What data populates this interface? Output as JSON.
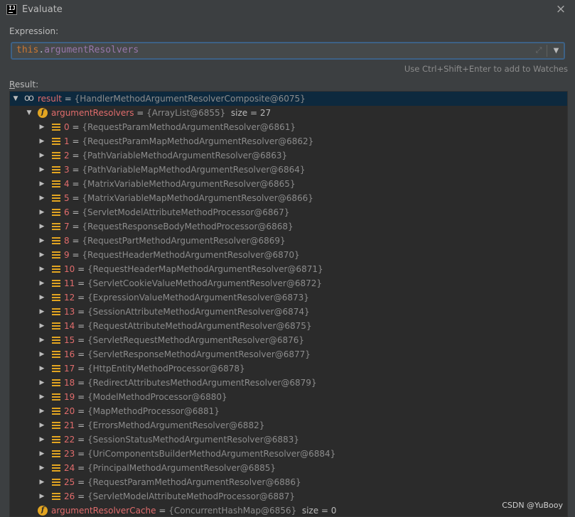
{
  "window": {
    "title": "Evaluate",
    "icon": "intellij-idea-icon",
    "close": "×"
  },
  "expression": {
    "label": "Expression:",
    "keyword": "this",
    "dot": ".",
    "field": "argumentResolvers",
    "expand_icon": "expand-icon",
    "dropdown_icon": "▼"
  },
  "hint": "Use Ctrl+Shift+Enter to add to Watches",
  "result": {
    "label_underlined": "R",
    "label_rest": "esult:",
    "root": {
      "name": "result",
      "eq": " = ",
      "value": "{HandlerMethodArgumentResolverComposite@6075}"
    },
    "resolvers": {
      "name": "argumentResolvers",
      "eq": " = ",
      "value": "{ArrayList@6855}",
      "size": "size = 27"
    },
    "items": [
      {
        "index": "0",
        "value": "{RequestParamMethodArgumentResolver@6861}"
      },
      {
        "index": "1",
        "value": "{RequestParamMapMethodArgumentResolver@6862}"
      },
      {
        "index": "2",
        "value": "{PathVariableMethodArgumentResolver@6863}"
      },
      {
        "index": "3",
        "value": "{PathVariableMapMethodArgumentResolver@6864}"
      },
      {
        "index": "4",
        "value": "{MatrixVariableMethodArgumentResolver@6865}"
      },
      {
        "index": "5",
        "value": "{MatrixVariableMapMethodArgumentResolver@6866}"
      },
      {
        "index": "6",
        "value": "{ServletModelAttributeMethodProcessor@6867}"
      },
      {
        "index": "7",
        "value": "{RequestResponseBodyMethodProcessor@6868}"
      },
      {
        "index": "8",
        "value": "{RequestPartMethodArgumentResolver@6869}"
      },
      {
        "index": "9",
        "value": "{RequestHeaderMethodArgumentResolver@6870}"
      },
      {
        "index": "10",
        "value": "{RequestHeaderMapMethodArgumentResolver@6871}"
      },
      {
        "index": "11",
        "value": "{ServletCookieValueMethodArgumentResolver@6872}"
      },
      {
        "index": "12",
        "value": "{ExpressionValueMethodArgumentResolver@6873}"
      },
      {
        "index": "13",
        "value": "{SessionAttributeMethodArgumentResolver@6874}"
      },
      {
        "index": "14",
        "value": "{RequestAttributeMethodArgumentResolver@6875}"
      },
      {
        "index": "15",
        "value": "{ServletRequestMethodArgumentResolver@6876}"
      },
      {
        "index": "16",
        "value": "{ServletResponseMethodArgumentResolver@6877}"
      },
      {
        "index": "17",
        "value": "{HttpEntityMethodProcessor@6878}"
      },
      {
        "index": "18",
        "value": "{RedirectAttributesMethodArgumentResolver@6879}"
      },
      {
        "index": "19",
        "value": "{ModelMethodProcessor@6880}"
      },
      {
        "index": "20",
        "value": "{MapMethodProcessor@6881}"
      },
      {
        "index": "21",
        "value": "{ErrorsMethodArgumentResolver@6882}"
      },
      {
        "index": "22",
        "value": "{SessionStatusMethodArgumentResolver@6883}"
      },
      {
        "index": "23",
        "value": "{UriComponentsBuilderMethodArgumentResolver@6884}"
      },
      {
        "index": "24",
        "value": "{PrincipalMethodArgumentResolver@6885}"
      },
      {
        "index": "25",
        "value": "{RequestParamMethodArgumentResolver@6886}"
      },
      {
        "index": "26",
        "value": "{ServletModelAttributeMethodProcessor@6887}"
      }
    ],
    "cache": {
      "name": "argumentResolverCache",
      "eq": " = ",
      "value": "{ConcurrentHashMap@6856}",
      "size": "size = 0"
    }
  },
  "watermark": "CSDN @YuBooy",
  "colors": {
    "background": "#3c3f41",
    "tree_background": "#2b2b2b",
    "selection": "#0d293e",
    "keyword": "#cc7832",
    "field": "#9876aa",
    "name": "#e06c6c",
    "value": "#8c8c8c",
    "icon": "#e3a521"
  }
}
